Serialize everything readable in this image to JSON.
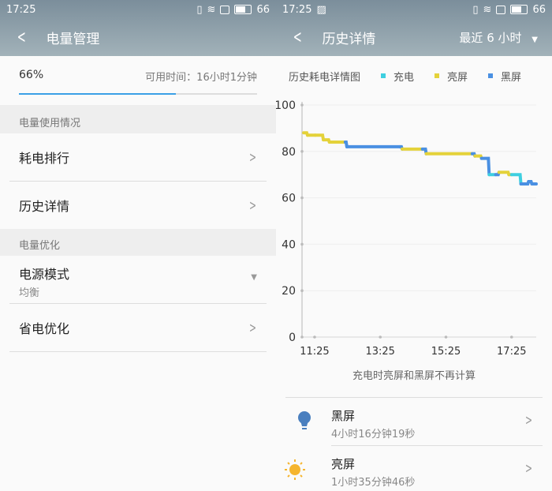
{
  "status": {
    "time": "17:25",
    "battery": "66"
  },
  "left": {
    "title": "电量管理",
    "percent": "66%",
    "level": 0.66,
    "available": "可用时间：16小时1分钟",
    "section1": "电量使用情况",
    "items1": [
      "耗电排行",
      "历史详情"
    ],
    "section2": "电量优化",
    "power_mode": {
      "label": "电源模式",
      "value": "均衡"
    },
    "save": "省电优化"
  },
  "right": {
    "title": "历史详情",
    "range": "最近 6 小时",
    "chart_title": "历史耗电详情图",
    "note": "充电时亮屏和黑屏不再计算",
    "items": [
      {
        "label": "黑屏",
        "value": "4小时16分钟19秒"
      },
      {
        "label": "亮屏",
        "value": "1小时35分钟46秒"
      }
    ]
  },
  "colors": {
    "charging": "#3ecfe0",
    "screen_on": "#e4d23a",
    "screen_off": "#4a90e2"
  },
  "chart_data": {
    "type": "line",
    "legend": [
      "充电",
      "亮屏",
      "黑屏"
    ],
    "ylim": [
      0,
      100
    ],
    "yticks": [
      "0",
      "20",
      "40",
      "60",
      "80",
      "100"
    ],
    "xticks": [
      {
        "t": 0,
        "label": "11:25"
      },
      {
        "t": 120,
        "label": "13:25"
      },
      {
        "t": 240,
        "label": "15:25"
      },
      {
        "t": 360,
        "label": "17:25"
      }
    ],
    "xlim": [
      -23,
      405
    ],
    "x_unit": "minutes since 11:25",
    "points": [
      [
        -20,
        88,
        "off"
      ],
      [
        -13,
        87,
        "on"
      ],
      [
        1,
        87,
        "on"
      ],
      [
        16,
        85,
        "on"
      ],
      [
        27,
        84,
        "on"
      ],
      [
        56,
        84,
        "on"
      ],
      [
        59,
        82,
        "off"
      ],
      [
        156,
        82,
        "off"
      ],
      [
        160,
        81,
        "off"
      ],
      [
        197,
        81,
        "on"
      ],
      [
        204,
        79,
        "off"
      ],
      [
        288,
        79,
        "on"
      ],
      [
        293,
        78,
        "off"
      ],
      [
        305,
        77,
        "on"
      ],
      [
        319,
        70,
        "off"
      ],
      [
        331,
        70,
        "charging"
      ],
      [
        337,
        71,
        "off"
      ],
      [
        355,
        70,
        "on"
      ],
      [
        360,
        70,
        "on"
      ],
      [
        377,
        66,
        "charging"
      ],
      [
        391,
        67,
        "off"
      ],
      [
        397,
        66,
        "off"
      ],
      [
        405,
        66,
        "off"
      ]
    ]
  }
}
